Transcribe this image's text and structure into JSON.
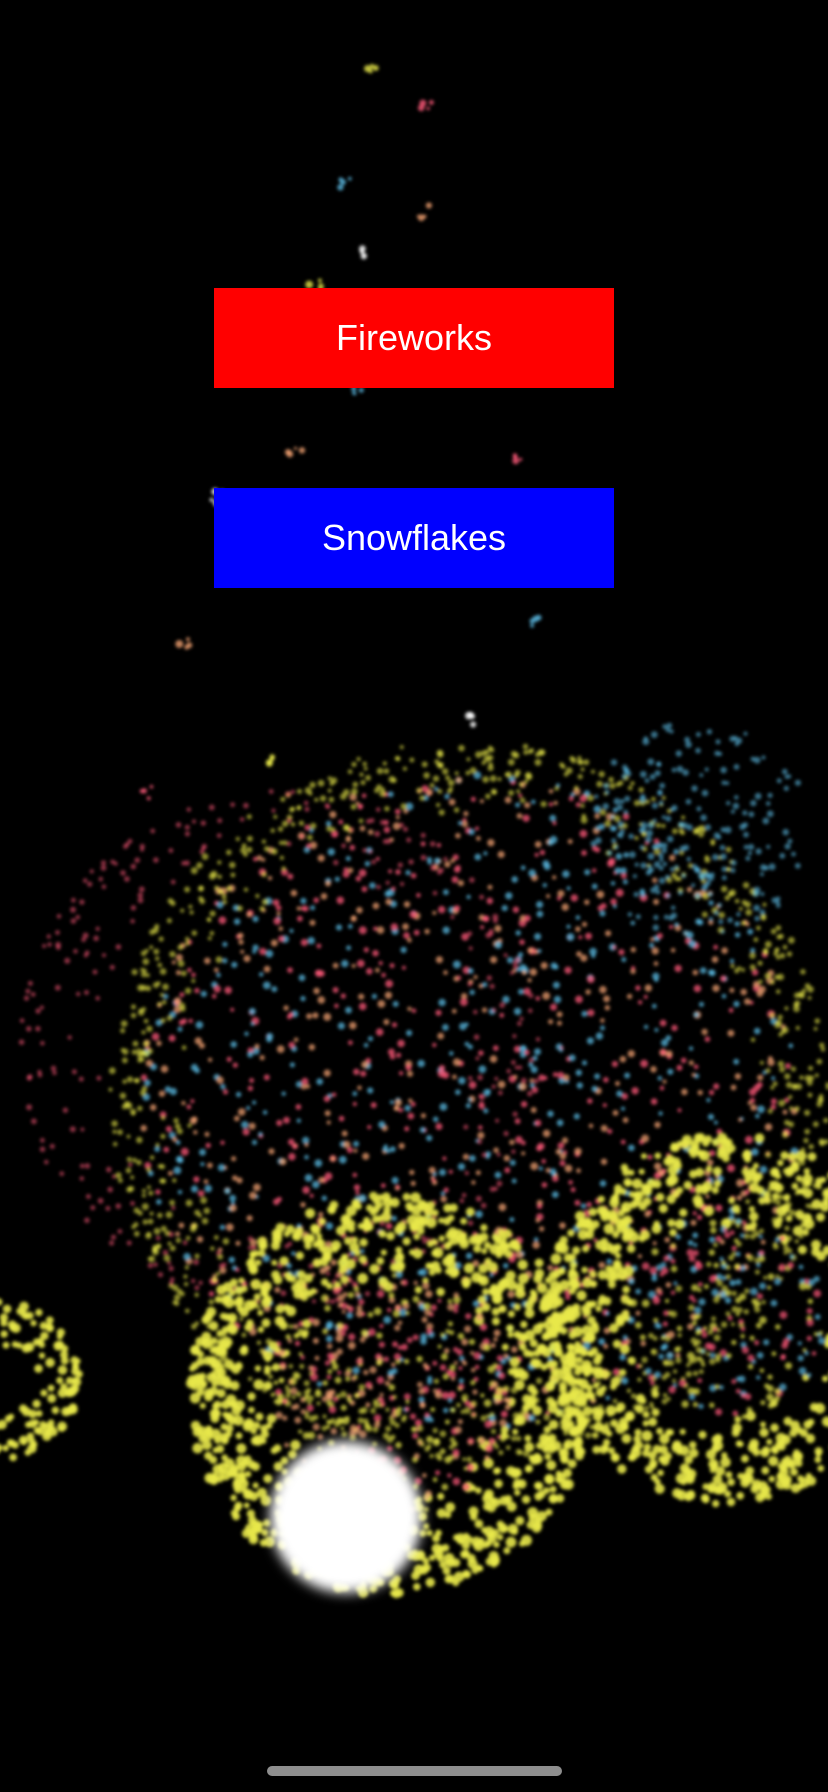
{
  "screen": {
    "background": "#000000"
  },
  "buttons": {
    "fireworks": {
      "label": "Fireworks",
      "color": "#ff0000"
    },
    "snowflakes": {
      "label": "Snowflakes",
      "color": "#0000ff"
    }
  },
  "particle_colors": [
    "#e8e84a",
    "#ff5a7a",
    "#5ab8e0",
    "#f0a070",
    "#ffffff"
  ],
  "home_indicator_color": "#8e8e8e"
}
